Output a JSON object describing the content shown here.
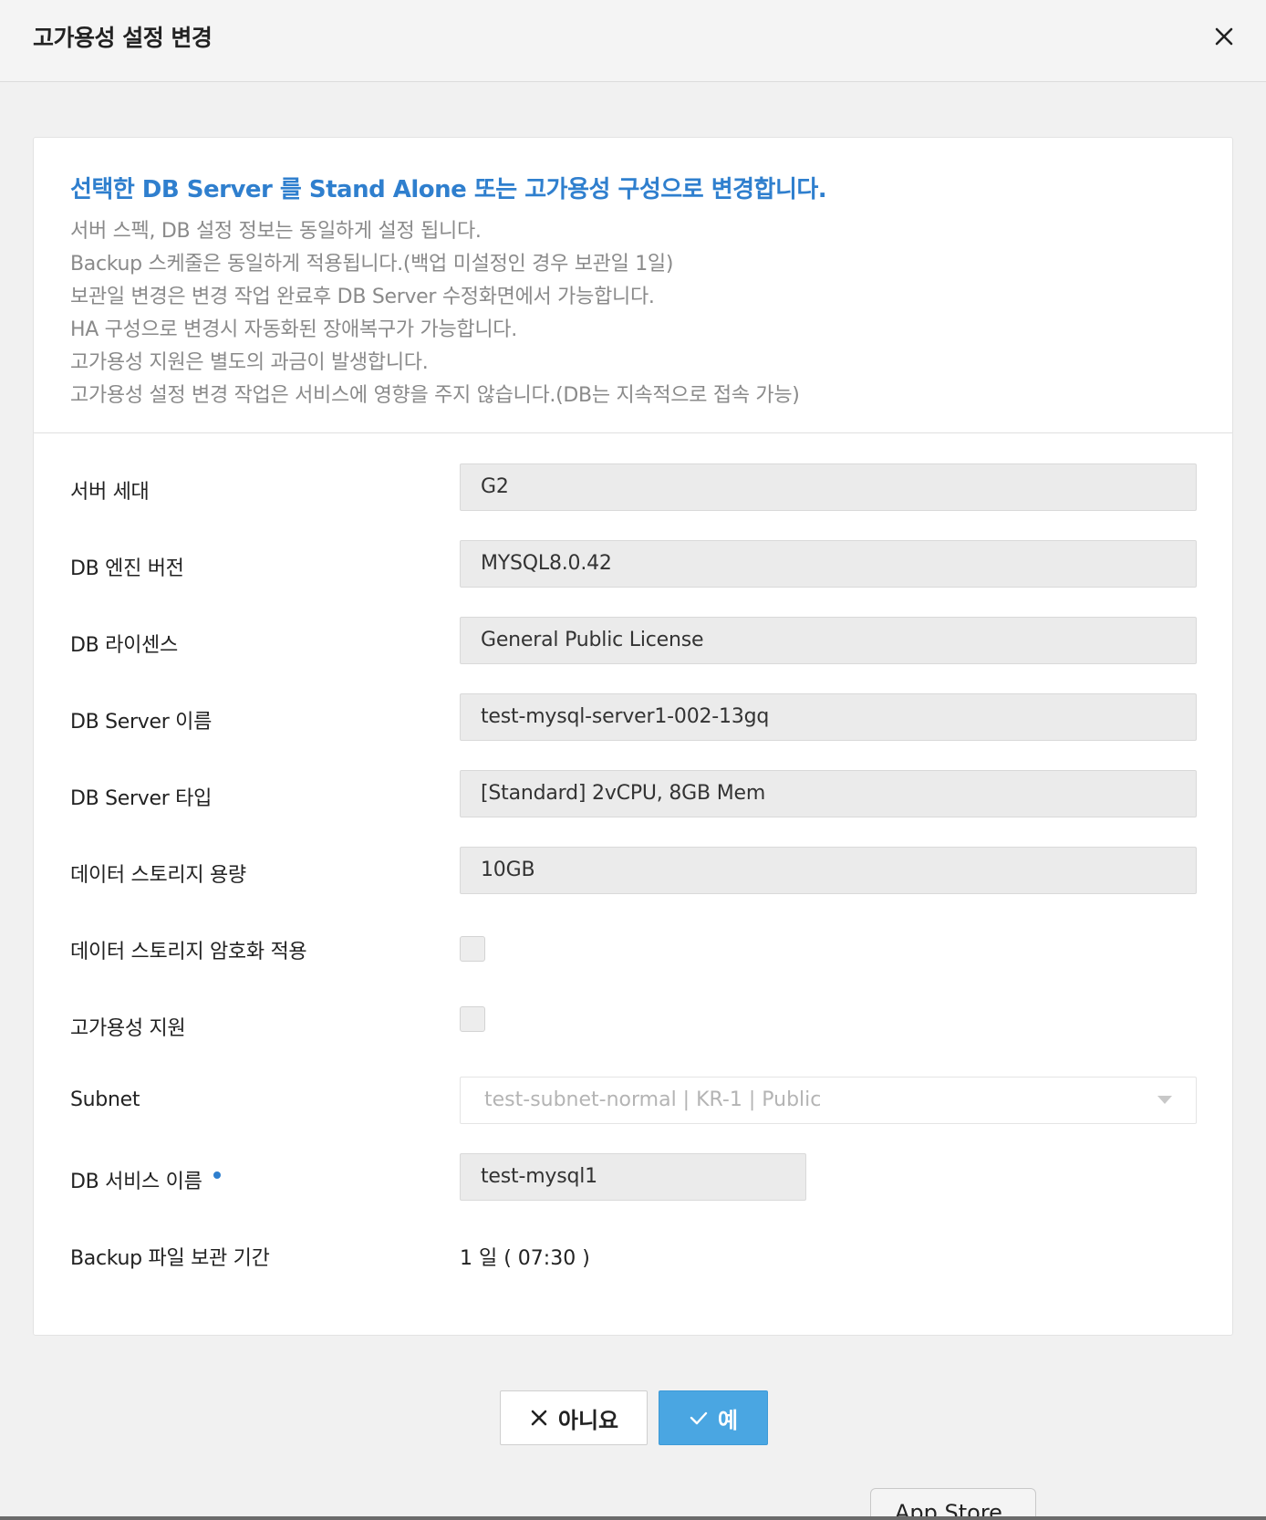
{
  "dialog": {
    "title": "고가용성 설정 변경"
  },
  "notice": {
    "title": "선택한 DB Server 를 Stand Alone 또는 고가용성 구성으로 변경합니다.",
    "lines": [
      "서버 스펙, DB 설정 정보는 동일하게 설정 됩니다.",
      "Backup 스케줄은 동일하게 적용됩니다.(백업 미설정인 경우 보관일 1일)",
      "보관일 변경은 변경 작업 완료후 DB Server 수정화면에서 가능합니다.",
      "HA 구성으로 변경시 자동화된 장애복구가 가능합니다.",
      "고가용성 지원은 별도의 과금이 발생합니다.",
      "고가용성 설정 변경 작업은 서비스에 영향을 주지 않습니다.(DB는 지속적으로 접속 가능)"
    ]
  },
  "form": {
    "server_gen": {
      "label": "서버 세대",
      "value": "G2"
    },
    "engine_version": {
      "label": "DB 엔진 버전",
      "value": "MYSQL8.0.42"
    },
    "license": {
      "label": "DB 라이센스",
      "value": "General Public License"
    },
    "server_name": {
      "label": "DB Server 이름",
      "value": "test-mysql-server1-002-13gq"
    },
    "server_type": {
      "label": "DB Server 타입",
      "value": "[Standard] 2vCPU, 8GB Mem"
    },
    "storage_size": {
      "label": "데이터 스토리지 용량",
      "value": "10GB"
    },
    "storage_encryption": {
      "label": "데이터 스토리지 암호화 적용",
      "checked": false
    },
    "ha_support": {
      "label": "고가용성 지원",
      "checked": false
    },
    "subnet": {
      "label": "Subnet",
      "value": "test-subnet-normal | KR-1 | Public"
    },
    "service_name": {
      "label": "DB 서비스 이름",
      "value": "test-mysql1"
    },
    "backup_retention": {
      "label": "Backup 파일 보관 기간",
      "value": "1 일 ( 07:30 )"
    }
  },
  "buttons": {
    "no_label": "아니요",
    "yes_label": "예"
  },
  "taskbar": {
    "app_store_label": "App Store"
  },
  "colors": {
    "accent": "#2f7fce",
    "primary_button": "#4aa6e2"
  }
}
